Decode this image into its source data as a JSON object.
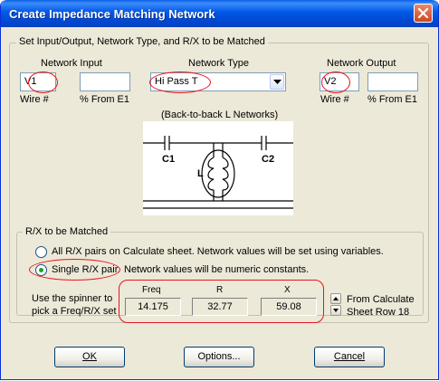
{
  "window": {
    "title": "Create Impedance Matching Network"
  },
  "setup_group": {
    "legend": "Set Input/Output, Network Type, and R/X to be Matched"
  },
  "network_input": {
    "label": "Network Input",
    "wire_value": "V1",
    "percent_value": "",
    "wire_label": "Wire #",
    "percent_label": "% From E1"
  },
  "network_type": {
    "label": "Network Type",
    "selected": "Hi Pass T"
  },
  "network_output": {
    "label": "Network Output",
    "wire_value": "V2",
    "percent_value": "",
    "wire_label": "Wire #",
    "percent_label": "% From E1"
  },
  "diagram": {
    "caption": "(Back-to-back L Networks)",
    "c1": "C1",
    "c2": "C2",
    "l": "L"
  },
  "rx_group": {
    "legend": "R/X to be Matched",
    "option_all": "All R/X pairs on Calculate sheet.  Network values will be set using variables.",
    "option_single": "Single R/X pair.",
    "option_single_note": "Network values will be numeric constants.",
    "selected_option": "single",
    "spinner_hint_line1": "Use the spinner to",
    "spinner_hint_line2": "pick a Freq/R/X set",
    "freq_label": "Freq",
    "freq_value": "14.175",
    "r_label": "R",
    "r_value": "32.77",
    "x_label": "X",
    "x_value": "59.08",
    "from_row_line1": "From Calculate",
    "from_row_line2": "Sheet Row 18"
  },
  "buttons": {
    "ok": "OK",
    "options": "Options...",
    "cancel": "Cancel"
  },
  "colors": {
    "title_bar": "#0058e6",
    "dialog_bg": "#ece9d8",
    "highlight": "#e8141e",
    "close_button": "#d2451f"
  },
  "icons": [
    "close-icon",
    "dropdown-arrow-icon",
    "spin-up-icon",
    "spin-down-icon"
  ]
}
